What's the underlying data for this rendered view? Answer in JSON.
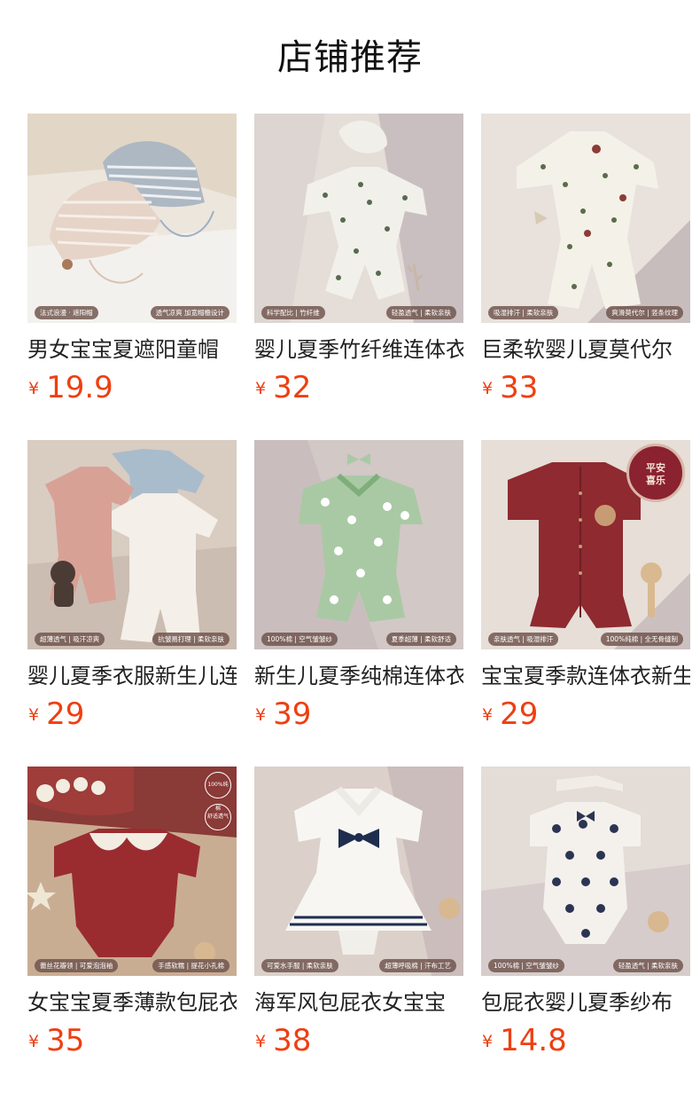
{
  "page": {
    "title": "店铺推荐"
  },
  "currency_symbol": "¥",
  "products": [
    {
      "name": "男女宝宝夏遮阳童帽",
      "price": "19.9",
      "tags": [
        "法式浪漫 · 遮阳帽",
        "透气凉爽 加宽帽檐设计"
      ]
    },
    {
      "name": "婴儿夏季竹纤维连体衣",
      "price": "32",
      "tags": [
        "科学配比 | 竹纤维",
        "轻盈透气 | 柔软亲肤"
      ]
    },
    {
      "name": "巨柔软婴儿夏莫代尔",
      "price": "33",
      "tags": [
        "吸湿排汗 | 柔软亲肤",
        "爽滑莫代尔 | 竖条纹理"
      ]
    },
    {
      "name": "婴儿夏季衣服新生儿连体衣",
      "price": "29",
      "tags": [
        "超薄透气 | 吸汗凉爽",
        "抗皱易打理 | 柔软亲肤"
      ]
    },
    {
      "name": "新生儿夏季纯棉连体衣",
      "price": "39",
      "tags": [
        "100%棉 | 空气皱皱纱",
        "夏季超薄 | 柔软舒适"
      ]
    },
    {
      "name": "宝宝夏季款连体衣新生",
      "price": "29",
      "tags": [
        "亲肤透气 | 吸湿排汗",
        "100%纯棉 | 全无骨缝制"
      ],
      "badge": "平安\n喜乐"
    },
    {
      "name": "女宝宝夏季薄款包屁衣",
      "price": "35",
      "tags": [
        "蕾丝花瓣领 | 可爱泡泡袖",
        "手感软糯 | 提花小孔棉"
      ],
      "side_icons": [
        "100%纯棉",
        "舒适透气"
      ]
    },
    {
      "name": "海军风包屁衣女宝宝",
      "price": "38",
      "tags": [
        "可爱水手服 | 柔软亲肤",
        "超薄呼吸棉 | 汗布工艺"
      ]
    },
    {
      "name": "包屁衣婴儿夏季纱布",
      "price": "14.8",
      "tags": [
        "100%棉 | 空气皱皱纱",
        "轻盈透气 | 柔软亲肤"
      ]
    }
  ],
  "colors": {
    "price": "#ee3f12",
    "tag_bg": "#6e524a"
  },
  "images": [
    "baby-bonnet-hats-photo",
    "bamboo-fiber-romper-photo",
    "modal-print-romper-photo",
    "long-sleeve-rompers-photo",
    "floral-short-sleeve-romper-photo",
    "burgundy-romper-photo",
    "lace-collar-bodysuit-photo",
    "sailor-dress-bodysuit-photo",
    "polka-dot-bodysuit-photo"
  ]
}
